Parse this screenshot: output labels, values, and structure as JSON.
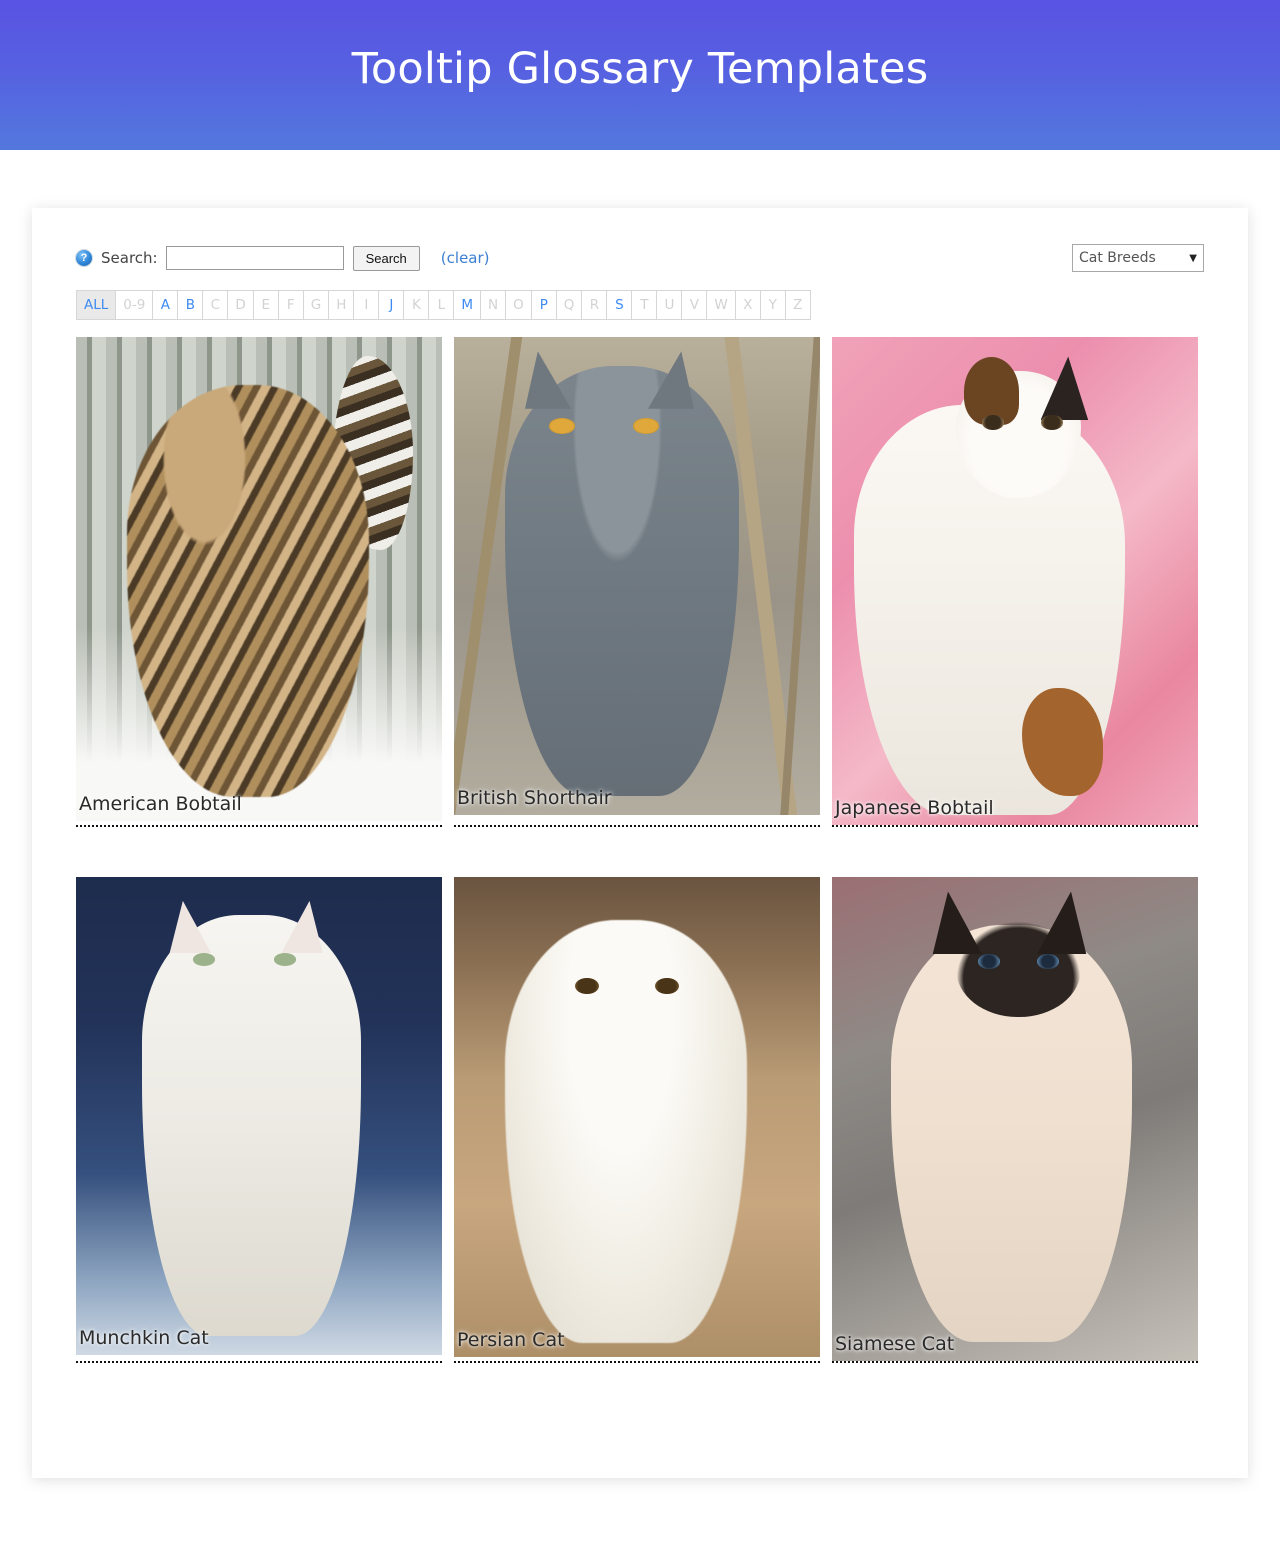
{
  "header": {
    "title": "Tooltip Glossary Templates",
    "gradient_from": "#5953e3",
    "gradient_to": "#5378dd"
  },
  "toolbar": {
    "help_icon": "help-circle-icon",
    "search_label": "Search:",
    "search_value": "",
    "search_placeholder": "",
    "search_button": "Search",
    "clear_link": "(clear)",
    "clear_link_color": "#3d7fd1",
    "category_select": {
      "selected": "Cat Breeds",
      "caret": "▼"
    }
  },
  "alphabet": {
    "active_color": "#3d8bf2",
    "inactive_color": "#d2d2d2",
    "items": [
      {
        "label": "ALL",
        "state": "selected"
      },
      {
        "label": "0-9",
        "state": "disabled"
      },
      {
        "label": "A",
        "state": "active"
      },
      {
        "label": "B",
        "state": "active"
      },
      {
        "label": "C",
        "state": "disabled"
      },
      {
        "label": "D",
        "state": "disabled"
      },
      {
        "label": "E",
        "state": "disabled"
      },
      {
        "label": "F",
        "state": "disabled"
      },
      {
        "label": "G",
        "state": "disabled"
      },
      {
        "label": "H",
        "state": "disabled"
      },
      {
        "label": "I",
        "state": "disabled"
      },
      {
        "label": "J",
        "state": "active"
      },
      {
        "label": "K",
        "state": "disabled"
      },
      {
        "label": "L",
        "state": "disabled"
      },
      {
        "label": "M",
        "state": "active"
      },
      {
        "label": "N",
        "state": "disabled"
      },
      {
        "label": "O",
        "state": "disabled"
      },
      {
        "label": "P",
        "state": "active"
      },
      {
        "label": "Q",
        "state": "disabled"
      },
      {
        "label": "R",
        "state": "disabled"
      },
      {
        "label": "S",
        "state": "active"
      },
      {
        "label": "T",
        "state": "disabled"
      },
      {
        "label": "U",
        "state": "disabled"
      },
      {
        "label": "V",
        "state": "disabled"
      },
      {
        "label": "W",
        "state": "disabled"
      },
      {
        "label": "X",
        "state": "disabled"
      },
      {
        "label": "Y",
        "state": "disabled"
      },
      {
        "label": "Z",
        "state": "disabled"
      }
    ]
  },
  "terms": [
    {
      "label": "American Bobtail"
    },
    {
      "label": "British Shorthair"
    },
    {
      "label": "Japanese Bobtail"
    },
    {
      "label": "Munchkin Cat"
    },
    {
      "label": "Persian Cat"
    },
    {
      "label": "Siamese Cat"
    }
  ]
}
